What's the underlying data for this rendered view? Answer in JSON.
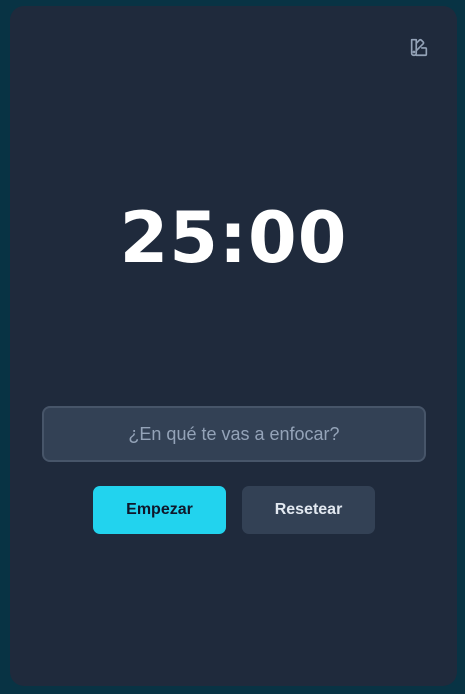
{
  "timer": {
    "display": "25:00"
  },
  "task_input": {
    "placeholder": "¿En qué te vas a enfocar?",
    "value": ""
  },
  "buttons": {
    "start_label": "Empezar",
    "reset_label": "Resetear"
  },
  "icons": {
    "theme_toggle": "palette-swatch-icon"
  },
  "colors": {
    "accent": "#22d3ee",
    "card_background": "#1f2a3c",
    "page_background": "#083344",
    "secondary_button": "#334155"
  }
}
